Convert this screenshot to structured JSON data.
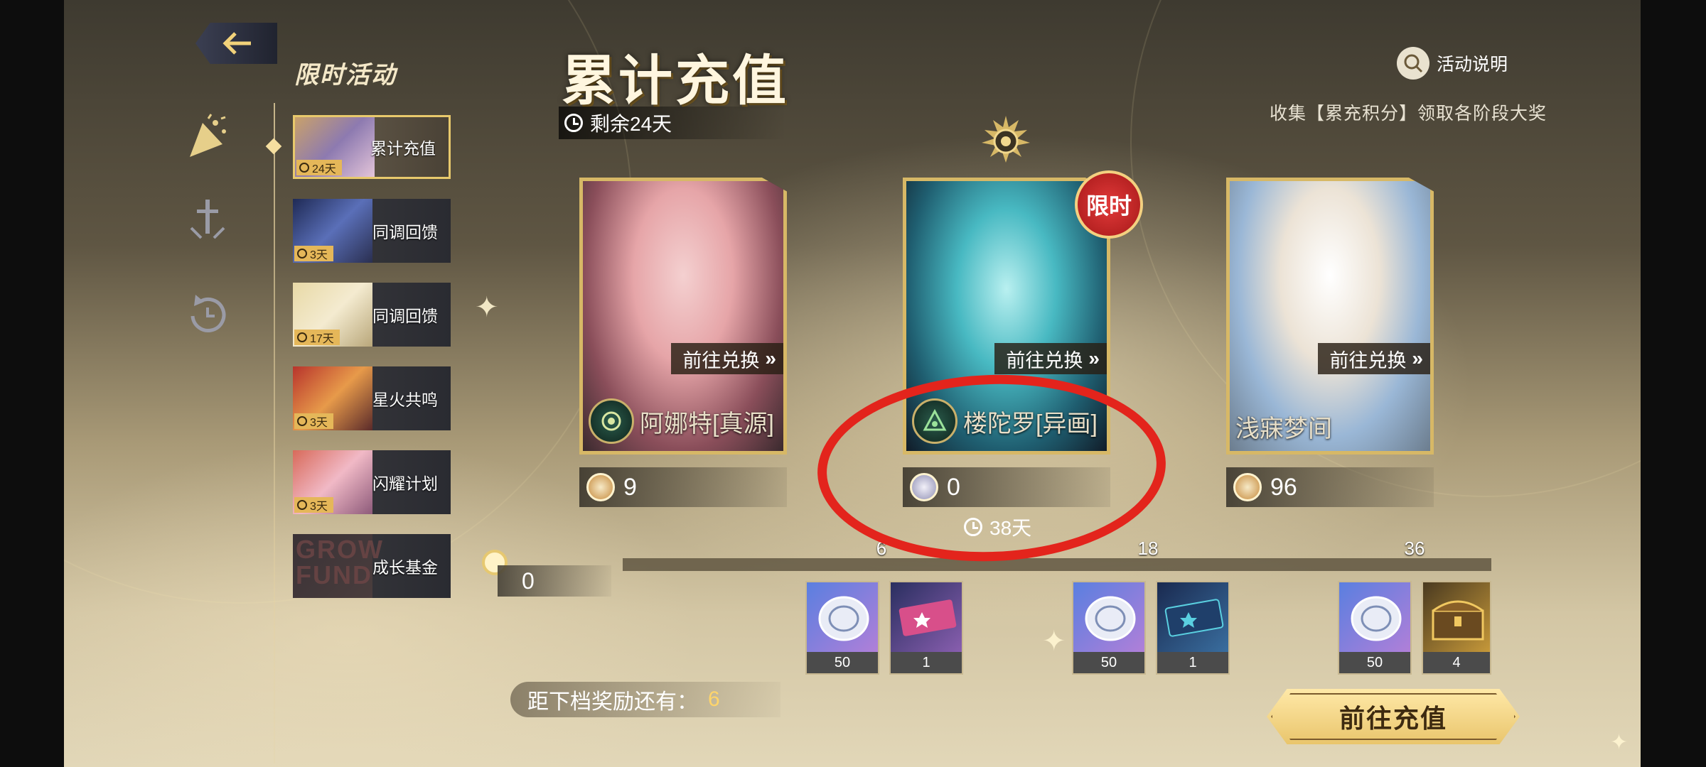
{
  "nav": {
    "back_label": "",
    "section_title": "限时活动"
  },
  "sidebar": {
    "tabs": [
      {
        "label": "累计充值",
        "days": "24天",
        "active": true
      },
      {
        "label": "同调回馈",
        "days": "3天"
      },
      {
        "label": "同调回馈",
        "days": "17天"
      },
      {
        "label": "星火共鸣",
        "days": "3天"
      },
      {
        "label": "闪耀计划",
        "days": "3天"
      },
      {
        "label": "成长基金",
        "thumb_text": "GROW FUND"
      }
    ]
  },
  "header": {
    "title": "累计充值",
    "remaining": "剩余24天",
    "help_label": "活动说明",
    "subtitle": "收集【累充积分】领取各阶段大奖"
  },
  "cards": [
    {
      "name": "阿娜特[真源]",
      "cta": "前往兑换",
      "count": "9",
      "coin": "gold"
    },
    {
      "name": "楼陀罗[异画]",
      "cta": "前往兑换",
      "count": "0",
      "coin": "silver",
      "badge": "限时",
      "timer": "38天"
    },
    {
      "name": "浅寐梦间",
      "cta": "前往兑换",
      "count": "96",
      "coin": "gold"
    }
  ],
  "progress": {
    "current": "0",
    "tiers": [
      "6",
      "18",
      "36"
    ],
    "rewards": [
      {
        "item": "silver-coin",
        "qty": "50"
      },
      {
        "item": "pink-ticket",
        "qty": "1"
      },
      {
        "item": "silver-coin",
        "qty": "50"
      },
      {
        "item": "blue-ticket",
        "qty": "1"
      },
      {
        "item": "silver-coin",
        "qty": "50"
      },
      {
        "item": "treasure-chest",
        "qty": "4"
      }
    ]
  },
  "footer": {
    "next_reward_label": "距下档奖励还有：",
    "next_reward_value": "6",
    "recharge_button": "前往充值"
  },
  "colors": {
    "gold_border": "#d7b866",
    "accent_yellow": "#ffd56a",
    "annotation_red": "#e3241c",
    "badge_red": "#d02828"
  }
}
